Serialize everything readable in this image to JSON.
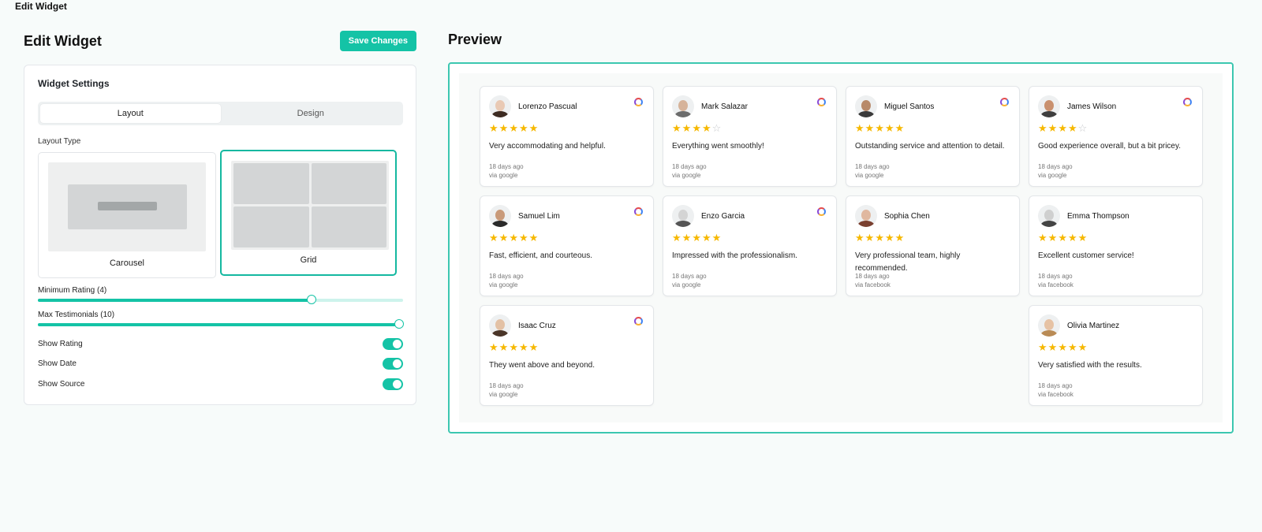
{
  "window": {
    "title": "Edit Widget"
  },
  "editor": {
    "title": "Edit Widget",
    "save_label": "Save Changes",
    "settings": {
      "title": "Widget Settings",
      "tabs": [
        {
          "label": "Layout",
          "active": true
        },
        {
          "label": "Design",
          "active": false
        }
      ],
      "layout_type_label": "Layout Type",
      "layout_options": [
        {
          "label": "Carousel",
          "selected": false
        },
        {
          "label": "Grid",
          "selected": true
        }
      ],
      "min_rating": {
        "label": "Minimum Rating (4)",
        "value": 4,
        "max": 5,
        "fraction": 0.75
      },
      "max_testimonials": {
        "label": "Max Testimonials (10)",
        "value": 10,
        "max": 10,
        "fraction": 0.99
      },
      "toggles": [
        {
          "label": "Show Rating",
          "on": true
        },
        {
          "label": "Show Date",
          "on": true
        },
        {
          "label": "Show Source",
          "on": true
        }
      ]
    }
  },
  "preview": {
    "title": "Preview",
    "accent_color": "#14c3a6",
    "star_color": "#f6b800",
    "columns": [
      [
        {
          "name": "Lorenzo Pascual",
          "rating": 5,
          "text": "Very accommodating and helpful.",
          "date": "18 days ago",
          "source": "via google",
          "icon": "google-icon"
        },
        {
          "name": "Samuel Lim",
          "rating": 5,
          "text": "Fast, efficient, and courteous.",
          "date": "18 days ago",
          "source": "via google",
          "icon": "google-icon"
        },
        {
          "name": "Isaac Cruz",
          "rating": 5,
          "text": "They went above and beyond.",
          "date": "18 days ago",
          "source": "via google",
          "icon": "google-icon"
        }
      ],
      [
        {
          "name": "Mark Salazar",
          "rating": 4,
          "text": "Everything went smoothly!",
          "date": "18 days ago",
          "source": "via google",
          "icon": "google-icon"
        },
        {
          "name": "Enzo Garcia",
          "rating": 5,
          "text": "Impressed with the professionalism.",
          "date": "18 days ago",
          "source": "via google",
          "icon": "google-icon"
        }
      ],
      [
        {
          "name": "Miguel Santos",
          "rating": 5,
          "text": "Outstanding service and attention to detail.",
          "date": "18 days ago",
          "source": "via google",
          "icon": "google-icon"
        },
        {
          "name": "Sophia Chen",
          "rating": 5,
          "text": "Very professional team, highly recommended.",
          "date": "18 days ago",
          "source": "via facebook",
          "icon": ""
        }
      ],
      [
        {
          "name": "James Wilson",
          "rating": 4,
          "text": "Good experience overall, but a bit pricey.",
          "date": "18 days ago",
          "source": "via google",
          "icon": "google-icon"
        },
        {
          "name": "Emma Thompson",
          "rating": 5,
          "text": "Excellent customer service!",
          "date": "18 days ago",
          "source": "via facebook",
          "icon": ""
        },
        {
          "name": "Olivia Martinez",
          "rating": 5,
          "text": "Very satisfied with the results.",
          "date": "18 days ago",
          "source": "via facebook",
          "icon": ""
        }
      ]
    ]
  }
}
